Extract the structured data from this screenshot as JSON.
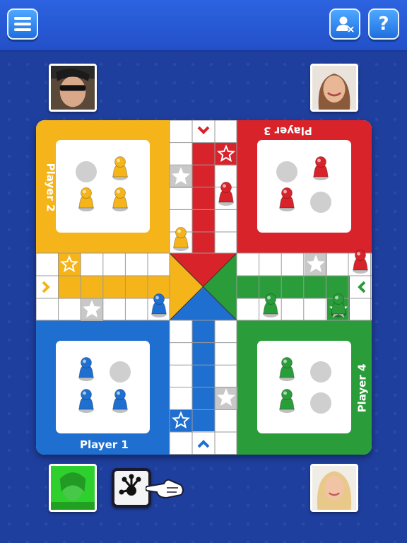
{
  "topbar": {
    "menu_icon": "hamburger-menu-icon",
    "friends_icon": "user-remove-icon",
    "help_glyph": "?"
  },
  "players": [
    {
      "label": "Player 1",
      "color": "#1e6fd0",
      "seat": "bottom-left"
    },
    {
      "label": "Player 2",
      "color": "#f4b41a",
      "seat": "top-left"
    },
    {
      "label": "Player 3",
      "color": "#d8232a",
      "seat": "top-right"
    },
    {
      "label": "Player 4",
      "color": "#2a9d3a",
      "seat": "bottom-right"
    }
  ],
  "colors": {
    "background": "#1f3f9e",
    "blue": "#1e6fd0",
    "yellow": "#f4b41a",
    "red": "#d8232a",
    "green": "#2a9d3a",
    "safe_cell": "#c8c8c8"
  },
  "dice": {
    "icon": "frog-paw-dice-icon",
    "pointer_icon": "pointing-hand-icon"
  }
}
